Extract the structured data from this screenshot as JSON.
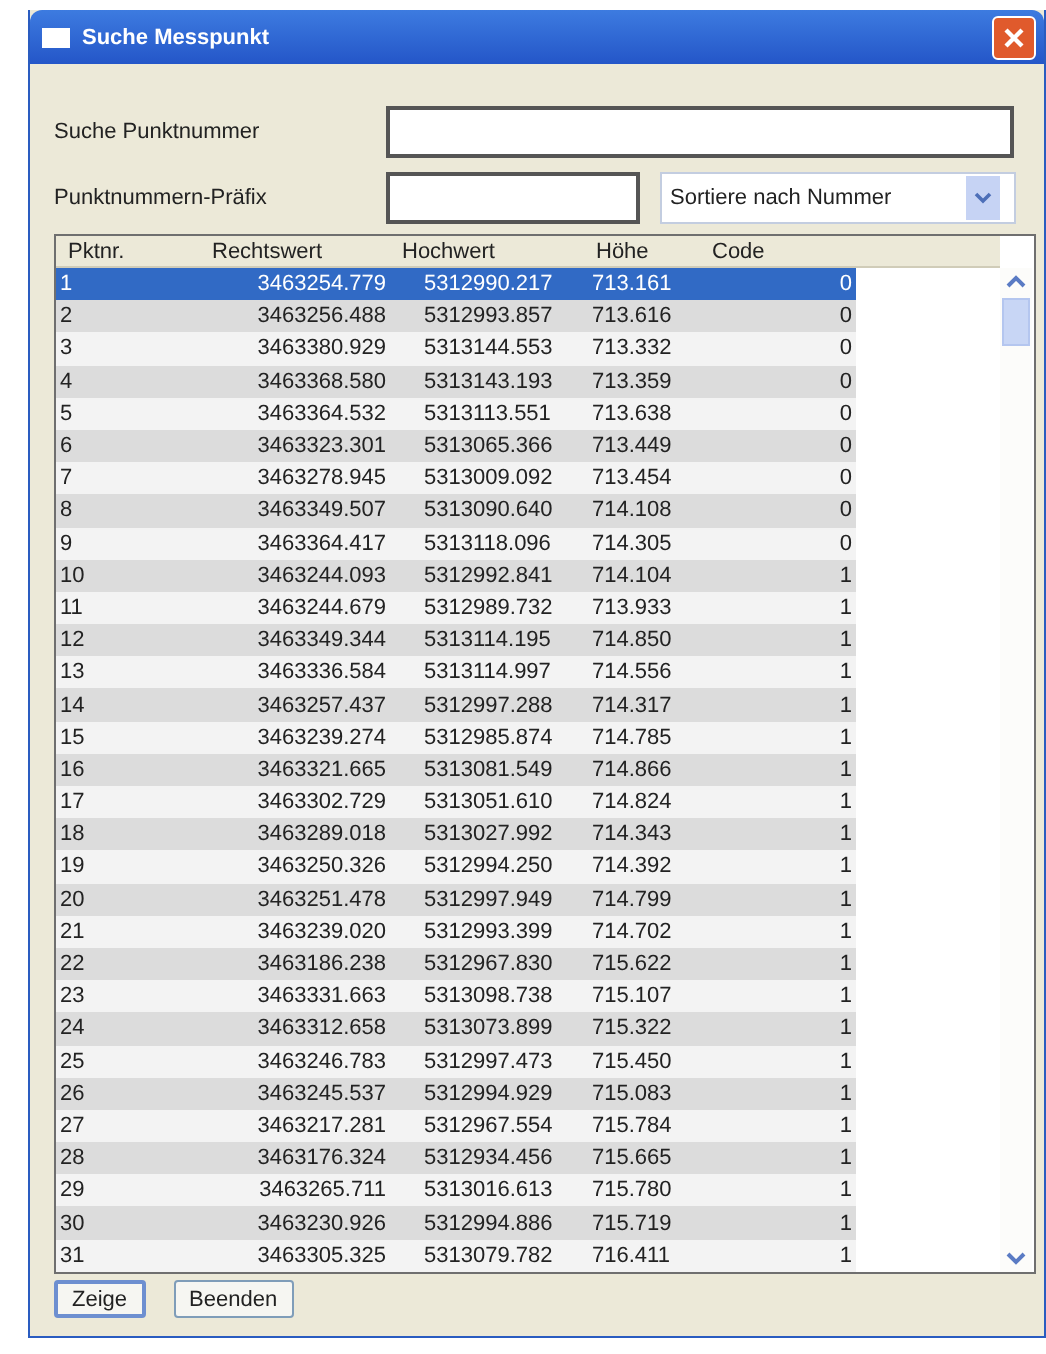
{
  "window": {
    "title": "Suche Messpunkt"
  },
  "search": {
    "label": "Suche Punktnummer"
  },
  "prefix": {
    "label": "Punktnummern-Präfix"
  },
  "sort": {
    "value": "Sortiere nach Nummer"
  },
  "table": {
    "columns": [
      "Pktnr.",
      "Rechtswert",
      "Hochwert",
      "Höhe",
      "Code"
    ],
    "rows": [
      {
        "cells": [
          "1",
          "3463254.779",
          "5312990.217",
          "713.161",
          "0"
        ],
        "selected": true
      },
      {
        "cells": [
          "2",
          "3463256.488",
          "5312993.857",
          "713.616",
          "0"
        ],
        "selected": false
      },
      {
        "cells": [
          "3",
          "3463380.929",
          "5313144.553",
          "713.332",
          "0"
        ],
        "selected": false
      },
      {
        "cells": [
          "4",
          "3463368.580",
          "5313143.193",
          "713.359",
          "0"
        ],
        "selected": false
      },
      {
        "cells": [
          "5",
          "3463364.532",
          "5313113.551",
          "713.638",
          "0"
        ],
        "selected": false
      },
      {
        "cells": [
          "6",
          "3463323.301",
          "5313065.366",
          "713.449",
          "0"
        ],
        "selected": false
      },
      {
        "cells": [
          "7",
          "3463278.945",
          "5313009.092",
          "713.454",
          "0"
        ],
        "selected": false
      },
      {
        "cells": [
          "8",
          "3463349.507",
          "5313090.640",
          "714.108",
          "0"
        ],
        "selected": false
      },
      {
        "cells": [
          "9",
          "3463364.417",
          "5313118.096",
          "714.305",
          "0"
        ],
        "selected": false
      },
      {
        "cells": [
          "10",
          "3463244.093",
          "5312992.841",
          "714.104",
          "1"
        ],
        "selected": false
      },
      {
        "cells": [
          "11",
          "3463244.679",
          "5312989.732",
          "713.933",
          "1"
        ],
        "selected": false
      },
      {
        "cells": [
          "12",
          "3463349.344",
          "5313114.195",
          "714.850",
          "1"
        ],
        "selected": false
      },
      {
        "cells": [
          "13",
          "3463336.584",
          "5313114.997",
          "714.556",
          "1"
        ],
        "selected": false
      },
      {
        "cells": [
          "14",
          "3463257.437",
          "5312997.288",
          "714.317",
          "1"
        ],
        "selected": false
      },
      {
        "cells": [
          "15",
          "3463239.274",
          "5312985.874",
          "714.785",
          "1"
        ],
        "selected": false
      },
      {
        "cells": [
          "16",
          "3463321.665",
          "5313081.549",
          "714.866",
          "1"
        ],
        "selected": false
      },
      {
        "cells": [
          "17",
          "3463302.729",
          "5313051.610",
          "714.824",
          "1"
        ],
        "selected": false
      },
      {
        "cells": [
          "18",
          "3463289.018",
          "5313027.992",
          "714.343",
          "1"
        ],
        "selected": false
      },
      {
        "cells": [
          "19",
          "3463250.326",
          "5312994.250",
          "714.392",
          "1"
        ],
        "selected": false
      },
      {
        "cells": [
          "20",
          "3463251.478",
          "5312997.949",
          "714.799",
          "1"
        ],
        "selected": false
      },
      {
        "cells": [
          "21",
          "3463239.020",
          "5312993.399",
          "714.702",
          "1"
        ],
        "selected": false
      },
      {
        "cells": [
          "22",
          "3463186.238",
          "5312967.830",
          "715.622",
          "1"
        ],
        "selected": false
      },
      {
        "cells": [
          "23",
          "3463331.663",
          "5313098.738",
          "715.107",
          "1"
        ],
        "selected": false
      },
      {
        "cells": [
          "24",
          "3463312.658",
          "5313073.899",
          "715.322",
          "1"
        ],
        "selected": false
      },
      {
        "cells": [
          "25",
          "3463246.783",
          "5312997.473",
          "715.450",
          "1"
        ],
        "selected": false
      },
      {
        "cells": [
          "26",
          "3463245.537",
          "5312994.929",
          "715.083",
          "1"
        ],
        "selected": false
      },
      {
        "cells": [
          "27",
          "3463217.281",
          "5312967.554",
          "715.784",
          "1"
        ],
        "selected": false
      },
      {
        "cells": [
          "28",
          "3463176.324",
          "5312934.456",
          "715.665",
          "1"
        ],
        "selected": false
      },
      {
        "cells": [
          "29",
          "3463265.711",
          "5313016.613",
          "715.780",
          "1"
        ],
        "selected": false
      },
      {
        "cells": [
          "30",
          "3463230.926",
          "5312994.886",
          "715.719",
          "1"
        ],
        "selected": false
      },
      {
        "cells": [
          "31",
          "3463305.325",
          "5313079.782",
          "716.411",
          "1"
        ],
        "selected": false
      }
    ]
  },
  "buttons": [
    "Zeige",
    "Beenden"
  ]
}
